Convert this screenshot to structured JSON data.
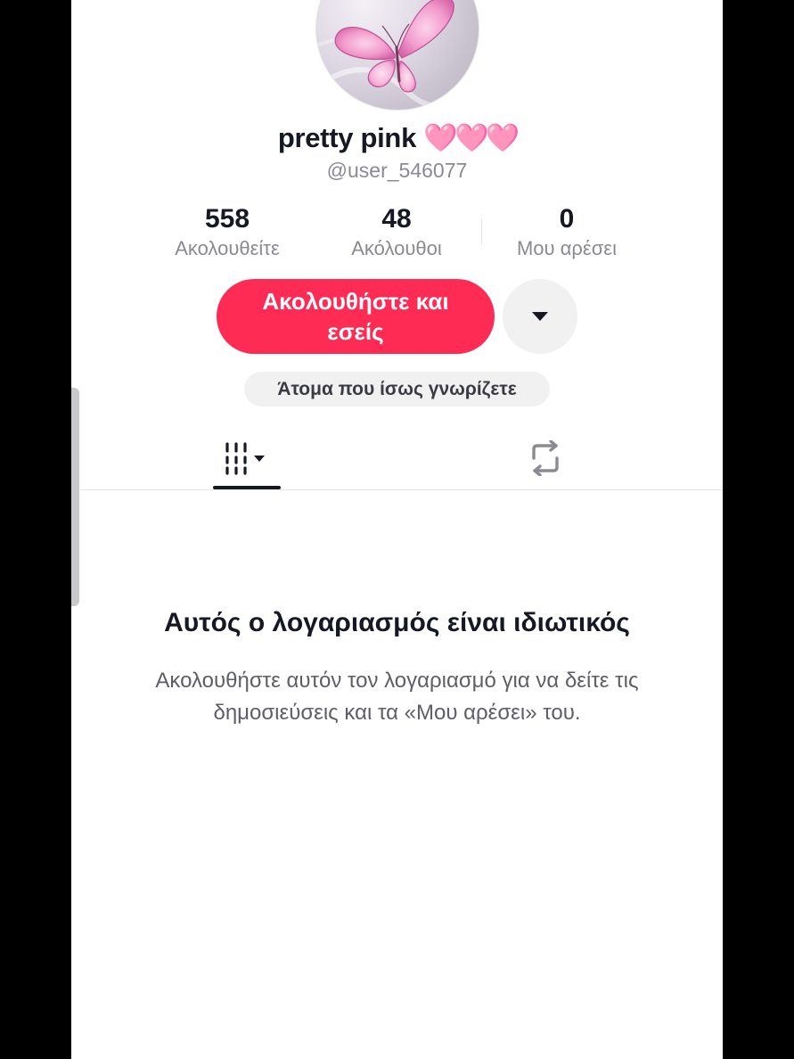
{
  "profile": {
    "display_name": "pretty pink",
    "name_emoji": "🩷🩷🩷",
    "username": "@user_546077"
  },
  "stats": [
    {
      "value": "558",
      "label": "Ακολουθείτε"
    },
    {
      "value": "48",
      "label": "Ακόλουθοι"
    },
    {
      "value": "0",
      "label": "Μου αρέσει"
    }
  ],
  "actions": {
    "follow_back_label": "Ακολουθήστε και εσείς",
    "more_icon": "caret-down-icon"
  },
  "suggestions": {
    "label": "Άτομα που ίσως γνωρίζετε"
  },
  "tabs": [
    {
      "name": "videos",
      "icon": "grid-columns-icon",
      "active": true
    },
    {
      "name": "reposts",
      "icon": "repost-icon",
      "active": false
    }
  ],
  "private_notice": {
    "title": "Αυτός ο λογαριασμός είναι ιδιωτικός",
    "description": "Ακολουθήστε αυτόν τον λογαριασμό για να δείτε τις δημοσιεύσεις και τα «Μου αρέσει» του."
  },
  "colors": {
    "accent": "#fe2c55",
    "text_primary": "#161823",
    "text_secondary": "#8a8b91"
  }
}
